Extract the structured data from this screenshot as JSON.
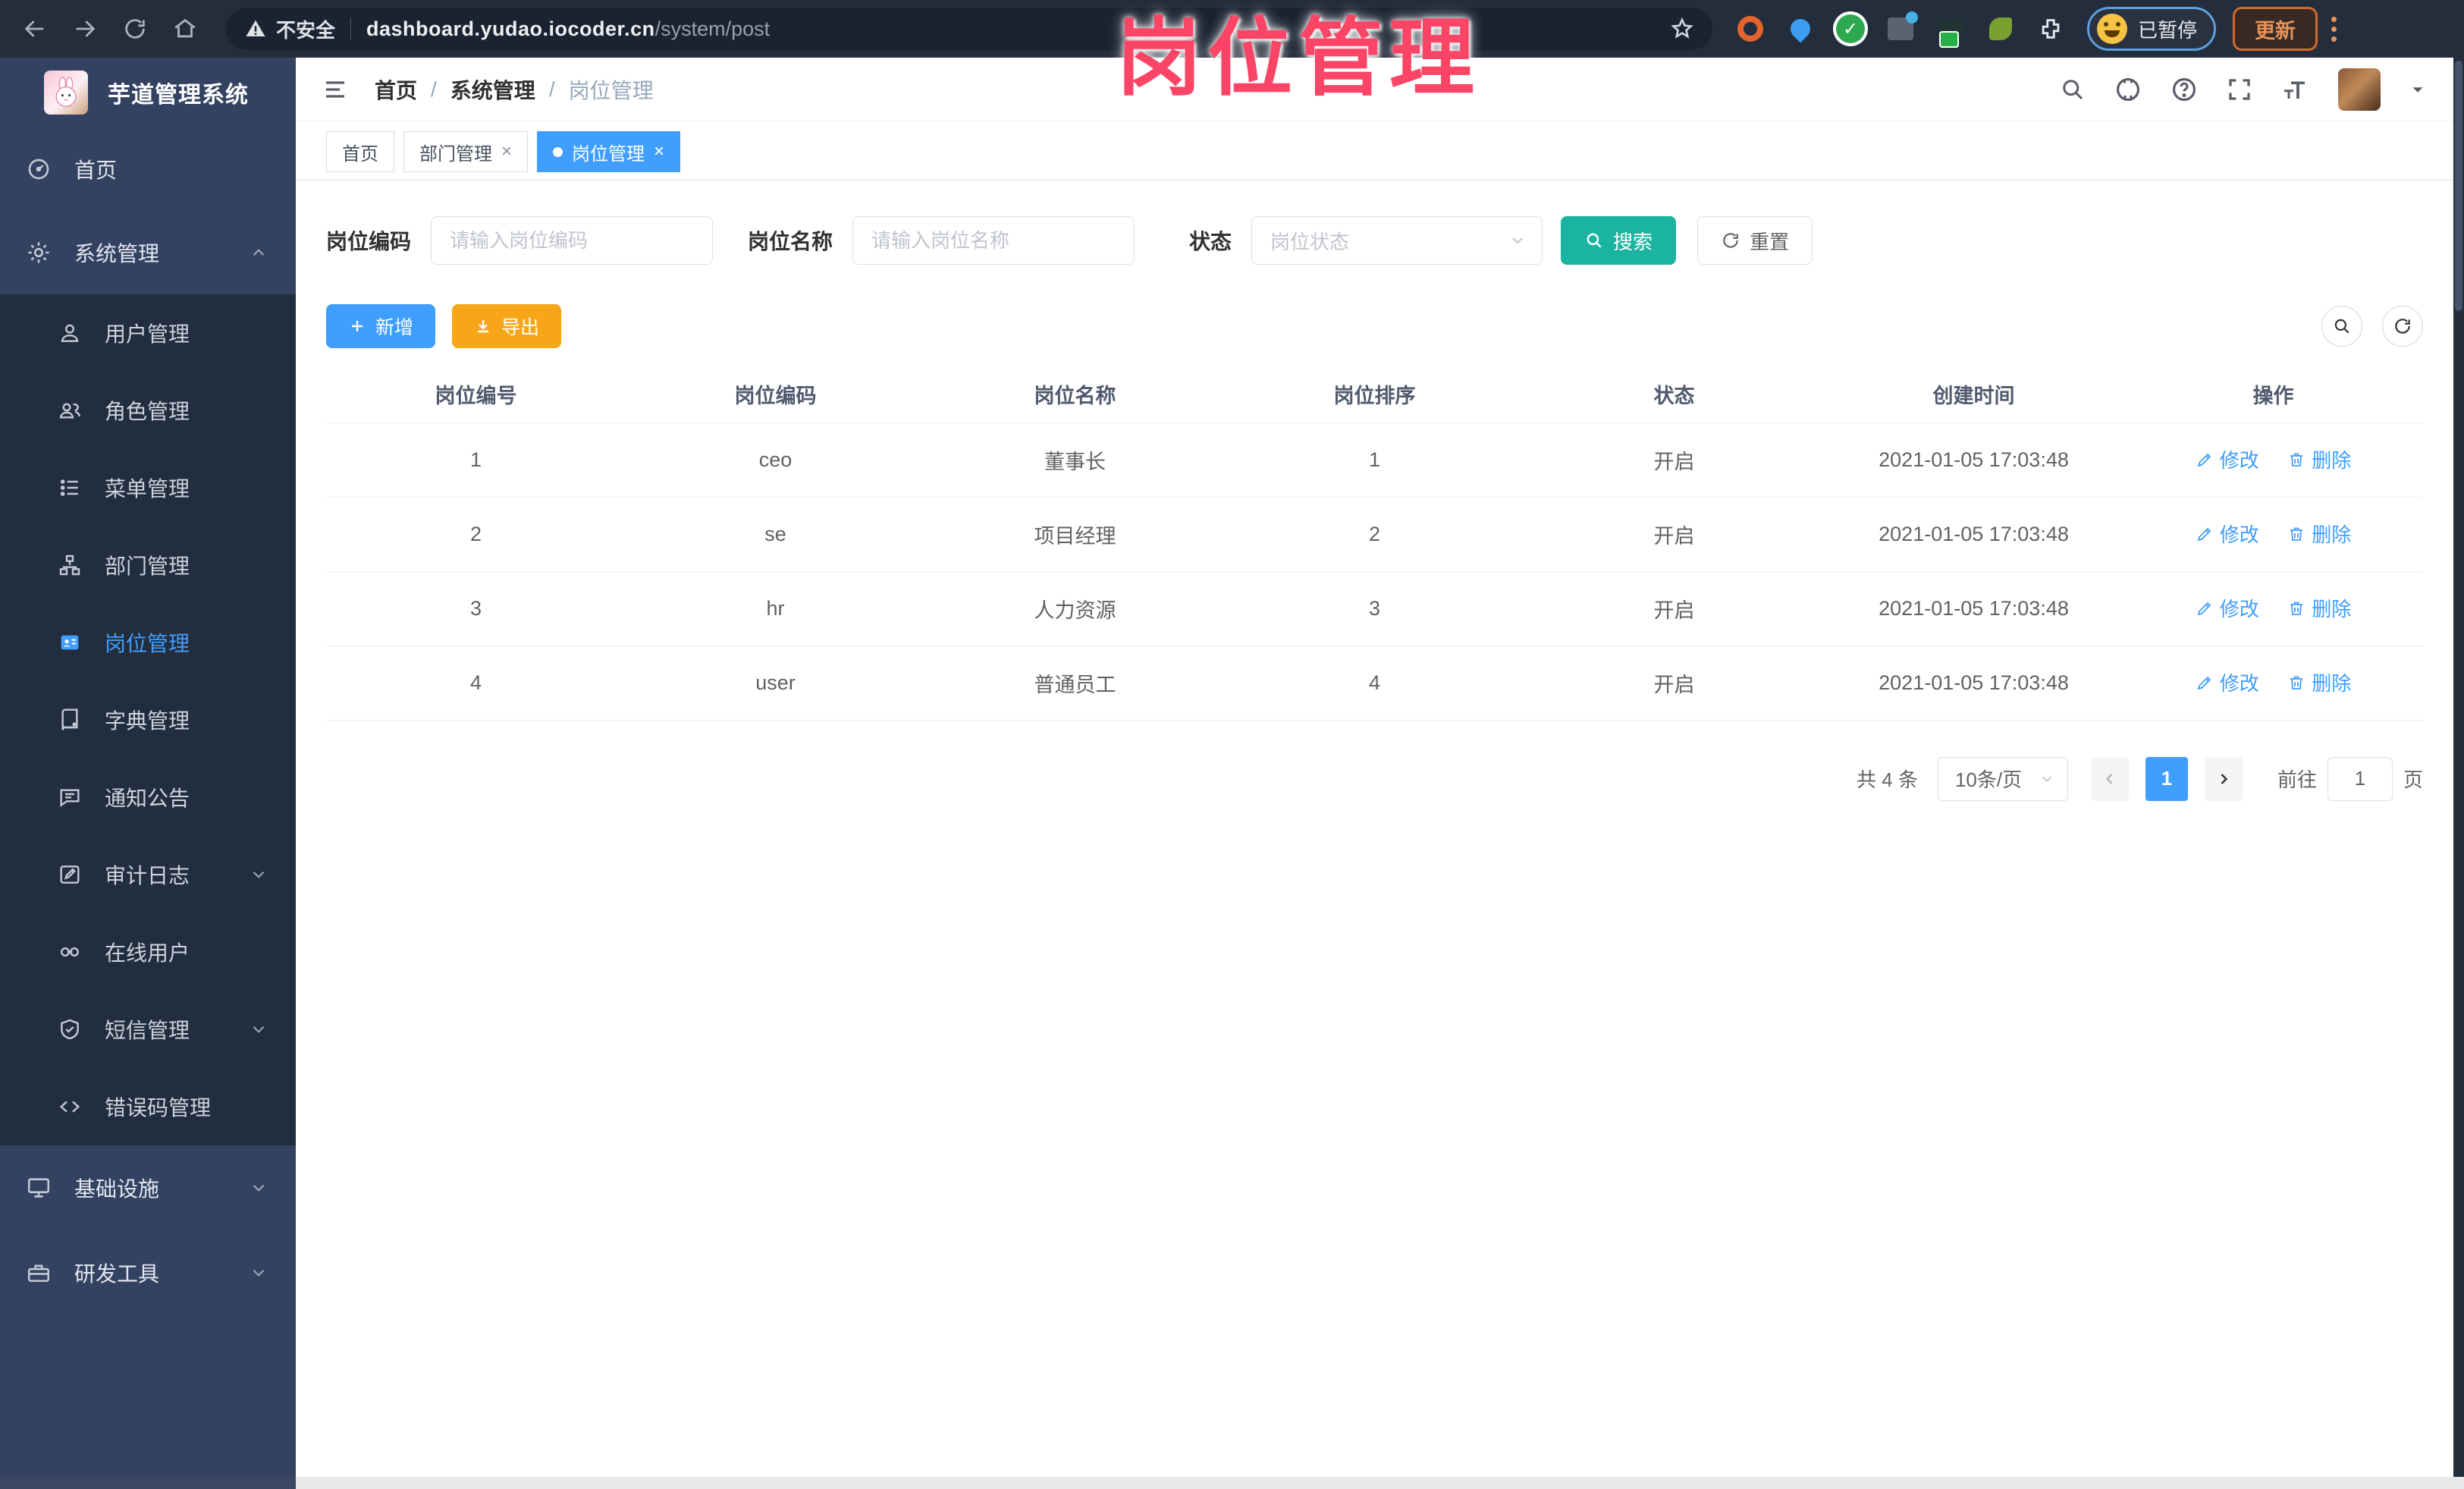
{
  "browser": {
    "security_label": "不安全",
    "url_domain": "dashboard.yudao.iocoder.cn",
    "url_path": "/system/post",
    "paused_badge": "已暂停",
    "update_button": "更新"
  },
  "watermark": "岗位管理",
  "ui": {
    "slash": "/",
    "close": "×"
  },
  "sidebar": {
    "title": "芋道管理系统",
    "items": [
      {
        "label": "首页"
      },
      {
        "label": "系统管理"
      },
      {
        "label": "用户管理"
      },
      {
        "label": "角色管理"
      },
      {
        "label": "菜单管理"
      },
      {
        "label": "部门管理"
      },
      {
        "label": "岗位管理"
      },
      {
        "label": "字典管理"
      },
      {
        "label": "通知公告"
      },
      {
        "label": "审计日志"
      },
      {
        "label": "在线用户"
      },
      {
        "label": "短信管理"
      },
      {
        "label": "错误码管理"
      },
      {
        "label": "基础设施"
      },
      {
        "label": "研发工具"
      }
    ]
  },
  "breadcrumb": [
    "首页",
    "系统管理",
    "岗位管理"
  ],
  "tabs": [
    {
      "label": "首页",
      "active": false,
      "closable": false
    },
    {
      "label": "部门管理",
      "active": false,
      "closable": true
    },
    {
      "label": "岗位管理",
      "active": true,
      "closable": true
    }
  ],
  "filters": {
    "post_code": {
      "label": "岗位编码",
      "placeholder": "请输入岗位编码"
    },
    "post_name": {
      "label": "岗位名称",
      "placeholder": "请输入岗位名称"
    },
    "status": {
      "label": "状态",
      "placeholder": "岗位状态"
    },
    "search_button": "搜索",
    "reset_button": "重置"
  },
  "toolbar": {
    "add_button": "新增",
    "export_button": "导出"
  },
  "table": {
    "columns": [
      "岗位编号",
      "岗位编码",
      "岗位名称",
      "岗位排序",
      "状态",
      "创建时间",
      "操作"
    ],
    "actions": {
      "edit": "修改",
      "delete": "删除"
    },
    "rows": [
      {
        "cells": [
          "1",
          "ceo",
          "董事长",
          "1",
          "开启",
          "2021-01-05 17:03:48"
        ]
      },
      {
        "cells": [
          "2",
          "se",
          "项目经理",
          "2",
          "开启",
          "2021-01-05 17:03:48"
        ]
      },
      {
        "cells": [
          "3",
          "hr",
          "人力资源",
          "3",
          "开启",
          "2021-01-05 17:03:48"
        ]
      },
      {
        "cells": [
          "4",
          "user",
          "普通员工",
          "4",
          "开启",
          "2021-01-05 17:03:48"
        ]
      }
    ]
  },
  "pagination": {
    "total": "共 4 条",
    "page_size": "10条/页",
    "current_page": "1",
    "goto_label": "前往",
    "goto_value": "1",
    "page_unit": "页"
  },
  "colors": {
    "primary": "#409eff",
    "search_teal": "#1bb4a0",
    "export_amber": "#f7a61a",
    "watermark_pink": "#fb4566",
    "sidebar_navy": "#344261",
    "submenu_dark": "#222d3d",
    "browser_bar": "#242d3c"
  }
}
